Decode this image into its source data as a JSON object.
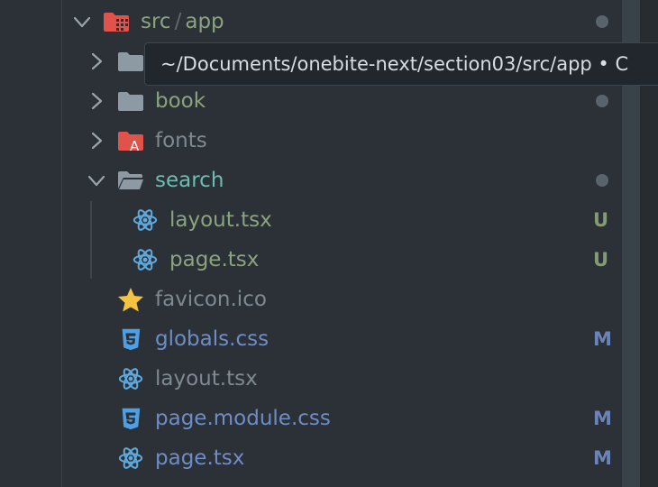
{
  "tree": {
    "root": {
      "label_src": "src",
      "label_sep": "/",
      "label_app": "app"
    },
    "hidden_folder": {
      "label": ""
    },
    "book": {
      "label": "book"
    },
    "fonts": {
      "label": "fonts"
    },
    "search": {
      "label": "search"
    },
    "search_layout": {
      "label": "layout.tsx",
      "badge": "U"
    },
    "search_page": {
      "label": "page.tsx",
      "badge": "U"
    },
    "favicon": {
      "label": "favicon.ico"
    },
    "globals": {
      "label": "globals.css",
      "badge": "M"
    },
    "layout": {
      "label": "layout.tsx"
    },
    "page_module": {
      "label": "page.module.css",
      "badge": "M"
    },
    "page": {
      "label": "page.tsx",
      "badge": "M"
    }
  },
  "tooltip": {
    "text": "~/Documents/onebite-next/section03/src/app • C"
  },
  "colors": {
    "background": "#2b3137",
    "git_folder_label": "#8ba37e",
    "open_folder_label": "#6ebdb2",
    "modified_label": "#6e8dc6",
    "badge_untracked": "#839a75",
    "badge_modified": "#6b84b8",
    "react_icon": "#5fa9dc",
    "css_icon": "#4ea0e6",
    "star_icon": "#f3c442",
    "fonts_folder_icon": "#e0534a"
  },
  "icons": {
    "root": "app-folder-icon",
    "folder": "folder-icon",
    "fonts": "font-folder-icon",
    "search": "folder-open-icon",
    "tsx": "react-icon",
    "ico": "star-icon",
    "css": "css-icon"
  }
}
